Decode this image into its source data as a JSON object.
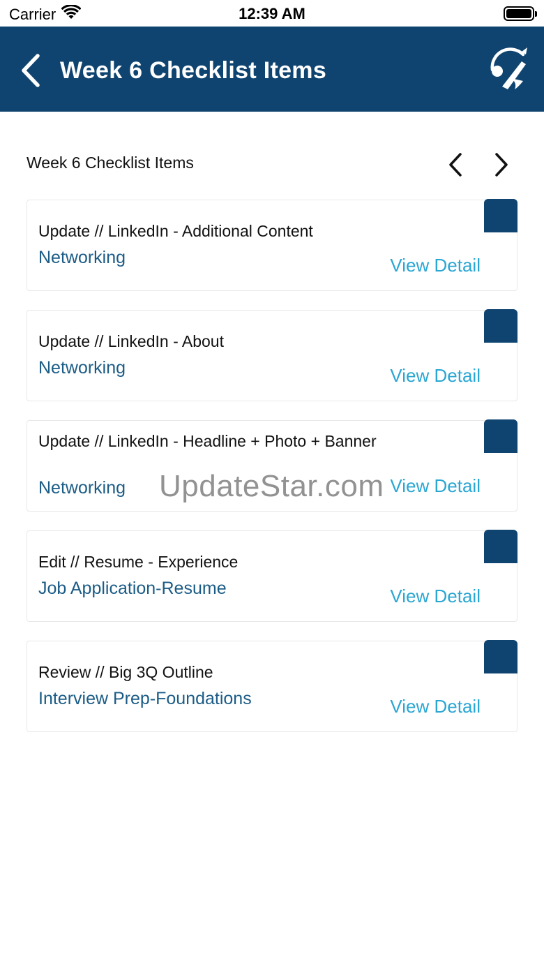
{
  "status_bar": {
    "carrier": "Carrier",
    "time": "12:39 AM"
  },
  "nav": {
    "title": "Week 6 Checklist Items"
  },
  "section": {
    "title": "Week 6 Checklist Items"
  },
  "items": [
    {
      "title": "Update // LinkedIn - Additional Content",
      "category": "Networking",
      "link": "View Detail"
    },
    {
      "title": "Update // LinkedIn - About",
      "category": "Networking",
      "link": "View Detail"
    },
    {
      "title": "Update // LinkedIn - Headline + Photo + Banner",
      "category": "Networking",
      "link": "View Detail"
    },
    {
      "title": "Edit // Resume - Experience",
      "category": "Job Application-Resume",
      "link": "View Detail"
    },
    {
      "title": "Review // Big 3Q Outline",
      "category": "Interview Prep-Foundations",
      "link": "View Detail"
    }
  ],
  "watermark": "UpdateStar.com",
  "colors": {
    "primary": "#0f4470",
    "category": "#1b5c86",
    "link": "#2aa6d3"
  },
  "icons": [
    "wifi-icon",
    "battery-icon",
    "back-chevron-icon",
    "app-logo-icon",
    "chevron-left-icon",
    "chevron-right-icon"
  ]
}
